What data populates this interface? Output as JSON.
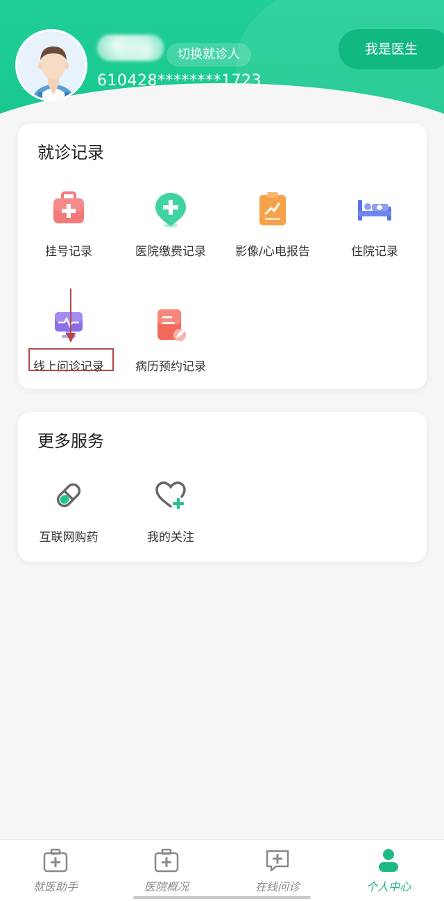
{
  "header": {
    "switch_label": "切换就诊人",
    "id_number": "610428********1723",
    "doctor_label": "我是医生"
  },
  "records": {
    "title": "就诊记录",
    "items": [
      {
        "label": "挂号记录",
        "icon": "medical-kit-icon"
      },
      {
        "label": "医院缴费记录",
        "icon": "location-plus-icon"
      },
      {
        "label": "影像/心电报告",
        "icon": "clipboard-report-icon"
      },
      {
        "label": "住院记录",
        "icon": "hospital-bed-icon"
      },
      {
        "label": "线上问诊记录",
        "icon": "monitor-pulse-icon"
      },
      {
        "label": "病历预约记录",
        "icon": "document-edit-icon"
      }
    ]
  },
  "services": {
    "title": "更多服务",
    "items": [
      {
        "label": "互联网购药",
        "icon": "pill-capsule-icon"
      },
      {
        "label": "我的关注",
        "icon": "heart-plus-icon"
      }
    ]
  },
  "nav": {
    "items": [
      {
        "label": "就医助手",
        "icon": "medkit-icon",
        "active": false
      },
      {
        "label": "医院概况",
        "icon": "hospital-icon",
        "active": false
      },
      {
        "label": "在线问诊",
        "icon": "chat-plus-icon",
        "active": false
      },
      {
        "label": "个人中心",
        "icon": "person-icon",
        "active": true
      }
    ]
  },
  "colors": {
    "brand": "#1fc995",
    "brand_dark": "#12b882",
    "annotation": "#b04a4a"
  }
}
